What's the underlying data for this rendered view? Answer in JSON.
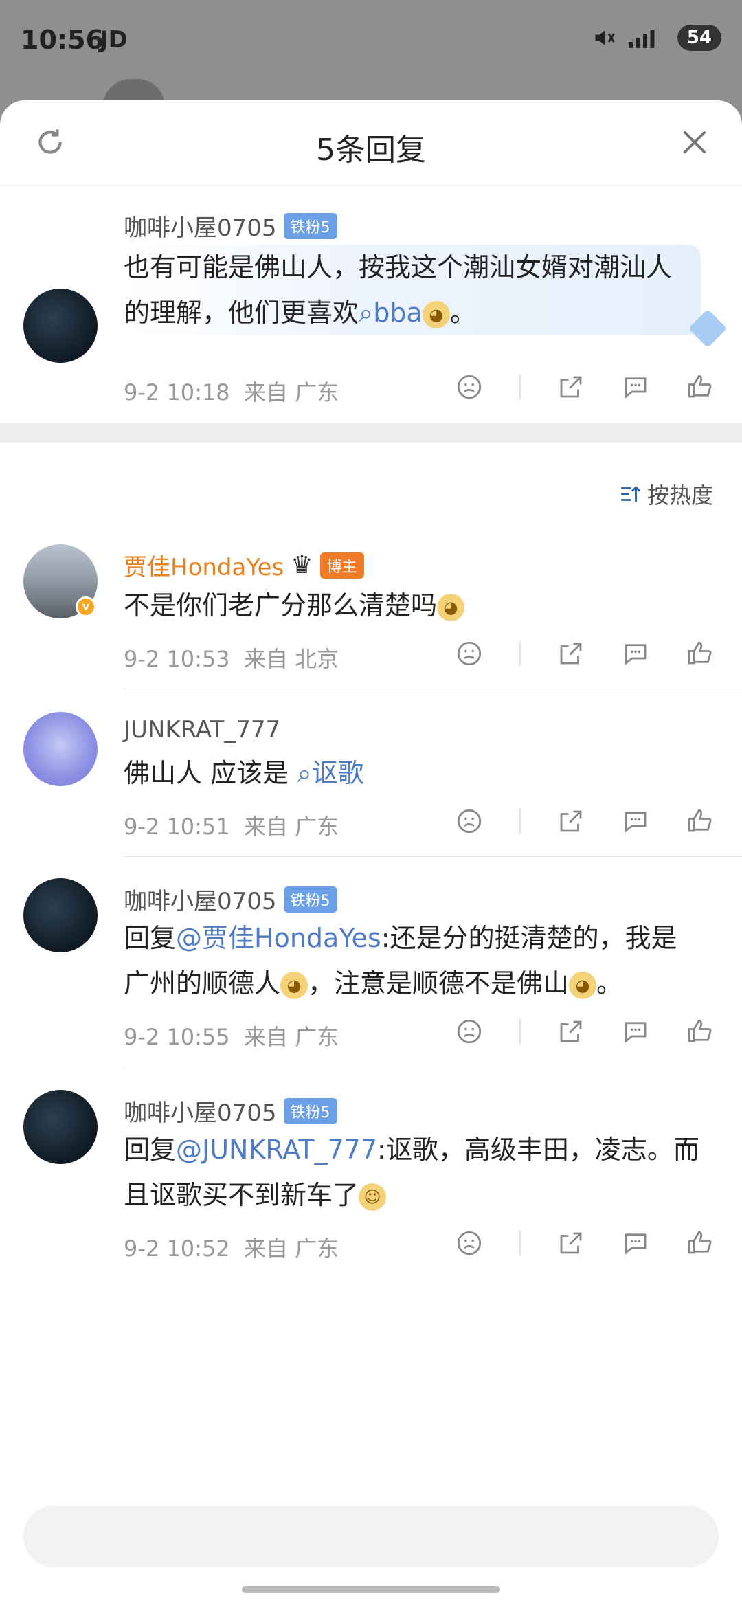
{
  "status_bar": {
    "time": "10:56",
    "apps": "JD",
    "battery": "54"
  },
  "header": {
    "title": "5条回复"
  },
  "top_comment": {
    "user": "咖啡小屋0705",
    "badge": "铁粉5",
    "text_before": "也有可能是佛山人，按我这个潮汕女婿对潮汕人的理解，他们更喜欢",
    "topic": "bba",
    "text_after": "。",
    "date": "9-2 10:18",
    "location": "来自 广东"
  },
  "sort": {
    "label": "按热度"
  },
  "replies": [
    {
      "user": "贾佳HondaYes",
      "badge": "博主",
      "text": "不是你们老广分那么清楚吗",
      "date": "9-2 10:53",
      "location": "来自 北京"
    },
    {
      "user": "JUNKRAT_777",
      "text_before": "佛山人 应该是",
      "topic": "讴歌",
      "date": "9-2 10:51",
      "location": "来自 广东"
    },
    {
      "user": "咖啡小屋0705",
      "badge": "铁粉5",
      "reply_prefix": "回复",
      "mention": "@贾佳HondaYes",
      "text_a": ":还是分的挺清楚的，我是广州的顺德人",
      "text_b": "，注意是顺德不是佛山",
      "text_c": "。",
      "date": "9-2 10:55",
      "location": "来自 广东"
    },
    {
      "user": "咖啡小屋0705",
      "badge": "铁粉5",
      "reply_prefix": "回复",
      "mention": "@JUNKRAT_777",
      "text_a": ":讴歌，高级丰田，凌志。而且讴歌买不到新车了",
      "date": "9-2 10:52",
      "location": "来自 广东"
    }
  ],
  "input": {
    "placeholder": ""
  }
}
